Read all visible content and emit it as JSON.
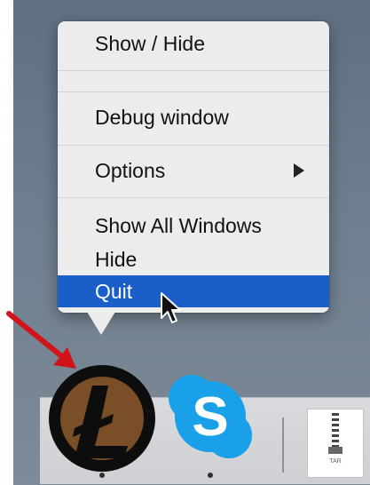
{
  "menu": {
    "items": [
      {
        "label": "Show / Hide"
      },
      {
        "label": "Debug window"
      },
      {
        "label": "Options",
        "submenu": true
      },
      {
        "label": "Show All Windows"
      },
      {
        "label": "Hide"
      },
      {
        "label": "Quit",
        "selected": true
      }
    ]
  },
  "dock": {
    "apps": [
      {
        "icon": "litecoin-icon",
        "running": true
      },
      {
        "icon": "skype-icon",
        "running": true
      },
      {
        "icon": "tar-archive-icon",
        "label": "TAR"
      }
    ]
  },
  "annotation": {
    "icon": "red-arrow-icon"
  },
  "colors": {
    "selection": "#1a5ec9",
    "menu_bg": "#ececec",
    "coin_brown": "#7a4e26",
    "skype_blue": "#1aa0e8",
    "arrow_red": "#d0141a"
  }
}
